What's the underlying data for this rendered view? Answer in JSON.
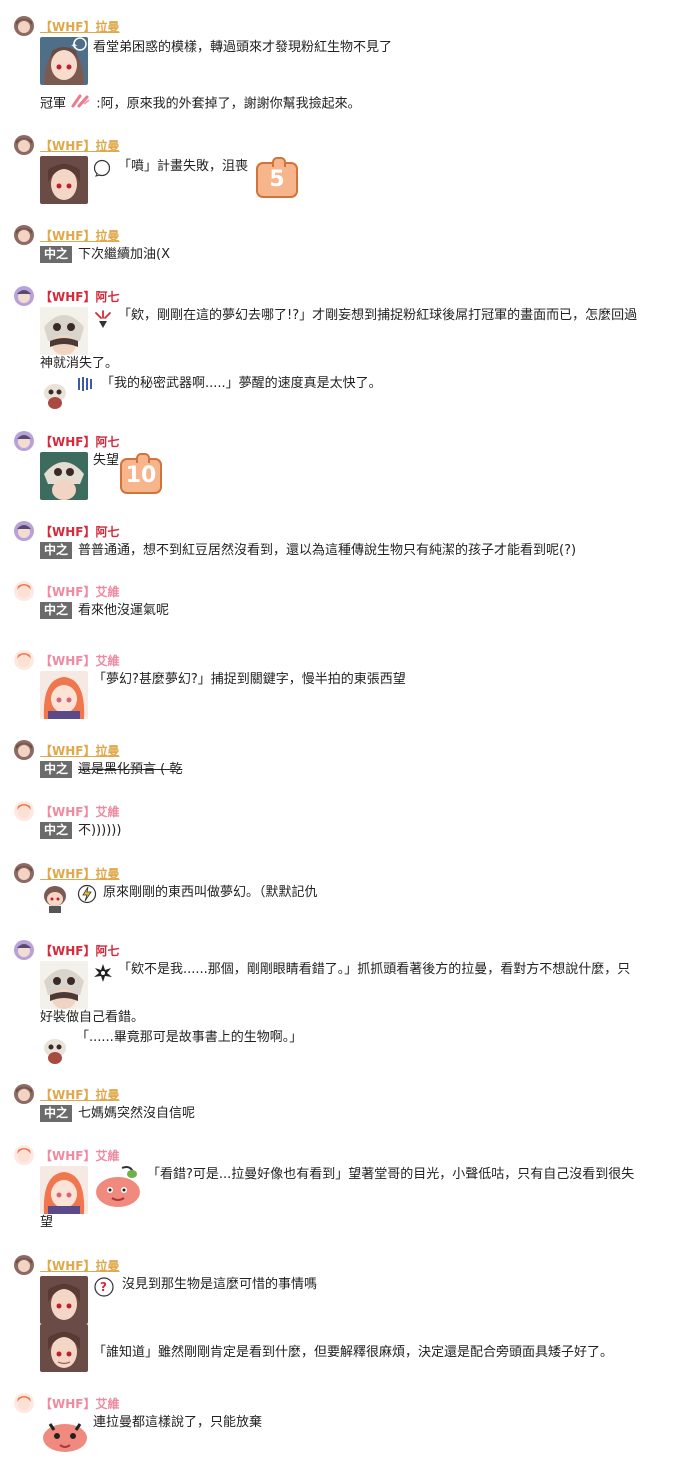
{
  "names": {
    "laman": "【WHF】拉曼",
    "aqi": "【WHF】阿七",
    "aiwei": "【WHF】艾維"
  },
  "tag_ooc": "中之",
  "posts": [
    {
      "line1": "看堂弟困惑的模樣，轉過頭來才發現粉紅生物不見了",
      "line2_prefix": "冠軍",
      "line2": ":阿，原來我的外套掉了，謝謝你幫我撿起來。"
    },
    {
      "line1": "「噴」計畫失敗，沮喪",
      "badge": "5"
    },
    {
      "line1": "下次繼續加油(X"
    },
    {
      "line1": "「欸，剛剛在這的夢幻去哪了!?」才剛妄想到捕捉粉紅球後屌打冠軍的畫面而已，怎麼回過",
      "line2": "神就消失了。",
      "line3": "「我的秘密武器啊.....」夢醒的速度真是太快了。"
    },
    {
      "line1": "失望",
      "badge": "10"
    },
    {
      "line1": "普普通通，想不到紅豆居然沒看到，還以為這種傳說生物只有純潔的孩子才能看到呢(?)"
    },
    {
      "line1": "看來他沒運氣呢"
    },
    {
      "line1": "「夢幻?甚麼夢幻?」捕捉到關鍵字，慢半拍的東張西望"
    },
    {
      "line1": "還是黑化預言 ( 乾"
    },
    {
      "line1": "不))))))"
    },
    {
      "line1": "原來剛剛的東西叫做夢幻。（默默記仇"
    },
    {
      "line1": "「欸不是我......那個，剛剛眼睛看錯了。」抓抓頭看著後方的拉曼，看對方不想說什麼，只",
      "line2": "好裝做自己看錯。",
      "line3": "「......畢竟那可是故事書上的生物啊。」"
    },
    {
      "line1": "七媽媽突然沒自信呢"
    },
    {
      "line1": "「看錯?可是...拉曼好像也有看到」望著堂哥的目光，小聲低咕，只有自己沒看到很失",
      "line2": "望"
    },
    {
      "line1": "沒見到那生物是這麼可惜的事情嗎",
      "line2": "「誰知道」雖然剛剛肯定是看到什麼，但要解釋很麻煩，決定還是配合旁頭面具矮子好了。"
    },
    {
      "line1": "連拉曼都這樣說了，只能放棄"
    }
  ],
  "colors": {
    "laman": "#e0a84a",
    "aqi": "#d62a3c",
    "aiwei": "#f08aa0",
    "tag_bg": "#6b6b6b"
  },
  "icons": [
    "speech-bubble-icon",
    "anger-mark-icon",
    "sweat-lines-icon",
    "lightning-bubble-icon",
    "spiky-mark-icon",
    "question-bubble-icon",
    "sparkle-icon"
  ]
}
